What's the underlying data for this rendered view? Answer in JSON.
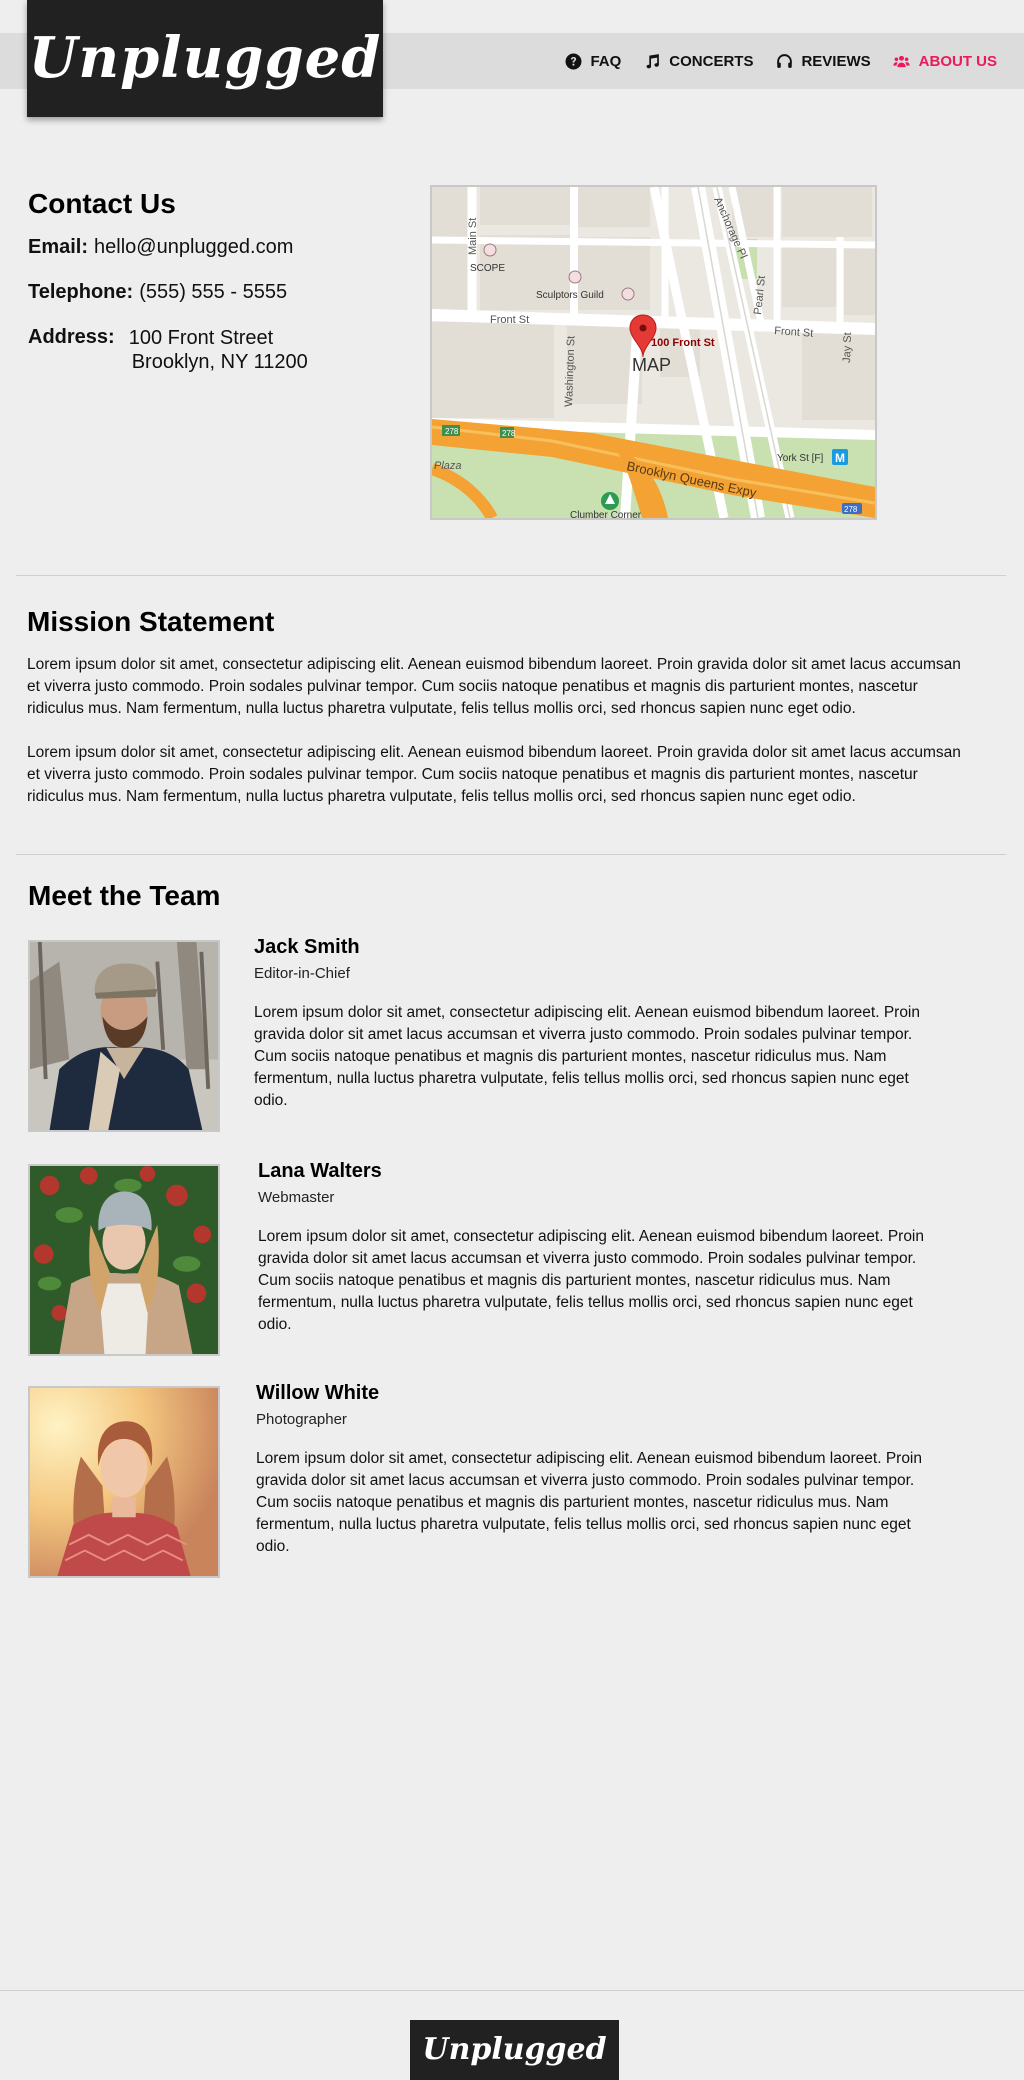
{
  "header": {
    "logo": "Unplugged",
    "nav": [
      {
        "label": "FAQ",
        "icon": "question-circle-icon"
      },
      {
        "label": "CONCERTS",
        "icon": "music-note-icon"
      },
      {
        "label": "REVIEWS",
        "icon": "headphones-icon"
      },
      {
        "label": "ABOUT US",
        "icon": "users-icon",
        "active": true
      }
    ],
    "active_color": "#ea1a5b"
  },
  "contact": {
    "title": "Contact Us",
    "email_label": "Email:",
    "email": "hello@unplugged.com",
    "phone_label": "Telephone:",
    "phone": "(555) 555 - 5555",
    "address_label": "Address:",
    "address_line1": "100 Front Street",
    "address_line2": "Brooklyn, NY 11200"
  },
  "map": {
    "label": "MAP",
    "pin_label": "100 Front St",
    "streets": [
      "Main St",
      "Front St",
      "Front St",
      "Washington St",
      "Anchorage Pl",
      "Pearl St",
      "Jay St",
      "Brooklyn Queens Expy",
      "Plaza"
    ],
    "places": [
      "SCOPE",
      "Sculptors Guild",
      "York St [F]",
      "Clumber Corner"
    ],
    "route_badges": [
      "278",
      "278",
      "278"
    ]
  },
  "mission": {
    "title": "Mission Statement",
    "paragraphs": [
      "Lorem ipsum dolor sit amet, consectetur adipiscing elit. Aenean euismod bibendum laoreet. Proin gravida dolor sit amet lacus accumsan et viverra justo commodo. Proin sodales pulvinar tempor. Cum sociis natoque penatibus et magnis dis parturient montes, nascetur ridiculus mus. Nam fermentum, nulla luctus pharetra vulputate, felis tellus mollis orci, sed rhoncus sapien nunc eget odio.",
      "Lorem ipsum dolor sit amet, consectetur adipiscing elit. Aenean euismod bibendum laoreet. Proin gravida dolor sit amet lacus accumsan et viverra justo commodo. Proin sodales pulvinar tempor. Cum sociis natoque penatibus et magnis dis parturient montes, nascetur ridiculus mus. Nam fermentum, nulla luctus pharetra vulputate, felis tellus mollis orci, sed rhoncus sapien nunc eget odio."
    ]
  },
  "team": {
    "title": "Meet the Team",
    "members": [
      {
        "name": "Jack Smith",
        "role": "Editor-in-Chief",
        "bio": "Lorem ipsum dolor sit amet, consectetur adipiscing elit. Aenean euismod bibendum laoreet. Proin gravida dolor sit amet lacus accumsan et viverra justo commodo. Proin sodales pulvinar tempor. Cum sociis natoque penatibus et magnis dis parturient montes, nascetur ridiculus mus. Nam fermentum, nulla luctus pharetra vulputate, felis tellus mollis orci, sed rhoncus sapien nunc eget odio."
      },
      {
        "name": "Lana Walters",
        "role": "Webmaster",
        "bio": "Lorem ipsum dolor sit amet, consectetur adipiscing elit. Aenean euismod bibendum laoreet. Proin gravida dolor sit amet lacus accumsan et viverra justo commodo. Proin sodales pulvinar tempor. Cum sociis natoque penatibus et magnis dis parturient montes, nascetur ridiculus mus. Nam fermentum, nulla luctus pharetra vulputate, felis tellus mollis orci, sed rhoncus sapien nunc eget odio."
      },
      {
        "name": "Willow White",
        "role": "Photographer",
        "bio": "Lorem ipsum dolor sit amet, consectetur adipiscing elit. Aenean euismod bibendum laoreet. Proin gravida dolor sit amet lacus accumsan et viverra justo commodo. Proin sodales pulvinar tempor. Cum sociis natoque penatibus et magnis dis parturient montes, nascetur ridiculus mus. Nam fermentum, nulla luctus pharetra vulputate, felis tellus mollis orci, sed rhoncus sapien nunc eget odio."
      }
    ]
  },
  "footer": {
    "logo": "Unplugged"
  }
}
